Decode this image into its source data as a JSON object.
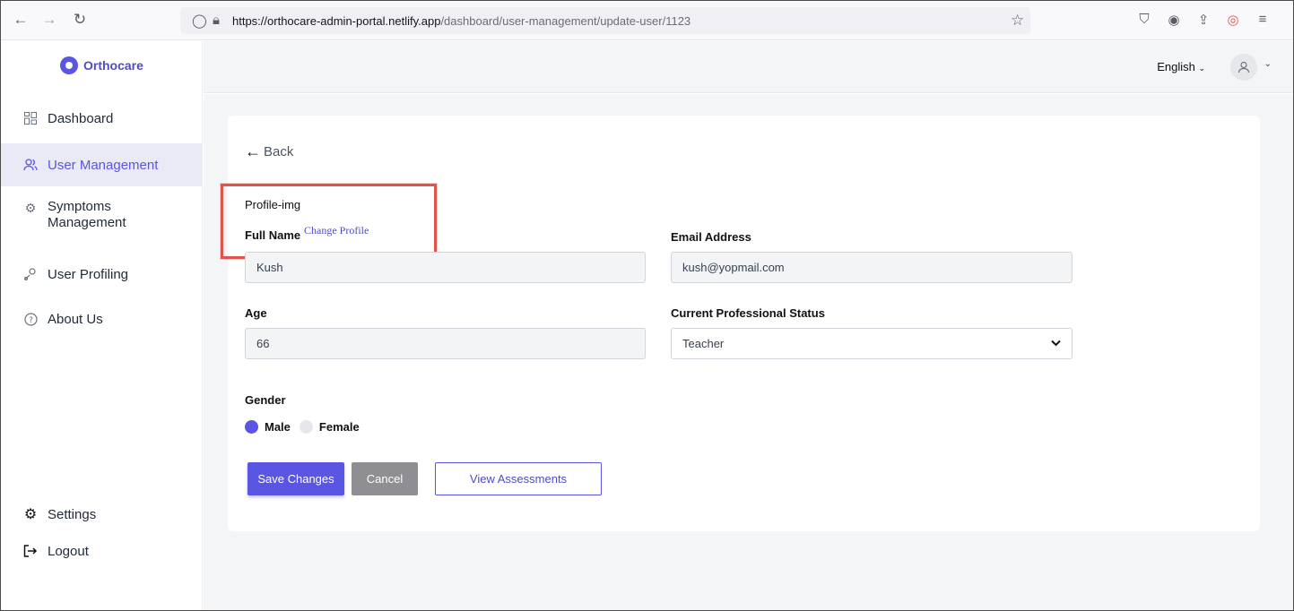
{
  "browser": {
    "url_host": "https://orthocare-admin-portal.netlify.app",
    "url_path": "/dashboard/user-management/update-user/1123"
  },
  "sidebar": {
    "logo_text": "Orthocare",
    "items": [
      {
        "label": "Dashboard",
        "icon": "dashboard-icon"
      },
      {
        "label": "User Management",
        "icon": "users-icon",
        "active": true
      },
      {
        "label": "Symptoms",
        "label2": "Management",
        "icon": "gear-icon"
      },
      {
        "label": "User Profiling",
        "icon": "profiling-icon"
      },
      {
        "label": "About Us",
        "icon": "help-icon"
      }
    ],
    "bottom": [
      {
        "label": "Settings",
        "icon": "settings-icon"
      },
      {
        "label": "Logout",
        "icon": "logout-icon"
      }
    ]
  },
  "header": {
    "language": "English"
  },
  "form": {
    "back_label": "Back",
    "profile_img_label": "Profile-img",
    "change_profile": "Change Profile",
    "full_name_label": "Full Name",
    "full_name_value": "Kush",
    "email_label": "Email Address",
    "email_value": "kush@yopmail.com",
    "age_label": "Age",
    "age_value": "66",
    "status_label": "Current Professional Status",
    "status_value": "Teacher",
    "gender_label": "Gender",
    "gender_options": [
      "Male",
      "Female"
    ],
    "gender_selected": "Male"
  },
  "actions": {
    "save": "Save Changes",
    "cancel": "Cancel",
    "view": "View Assessments"
  },
  "colors": {
    "accent": "#5a55e2",
    "highlight": "#e0544a",
    "cancel": "#8f8f93"
  }
}
